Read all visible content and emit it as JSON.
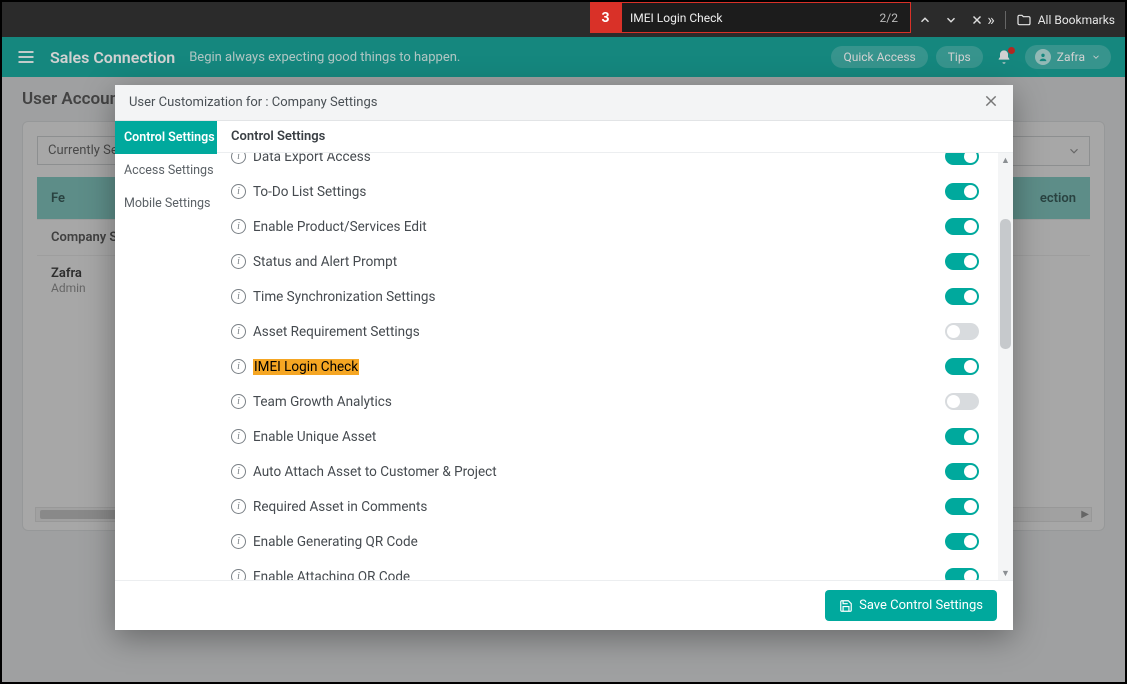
{
  "browser": {
    "find": {
      "badge": "3",
      "text": "IMEI Login Check",
      "count": "2/2"
    },
    "bookmarks_label": "All Bookmarks"
  },
  "header": {
    "title": "Sales Connection",
    "tagline": "Begin always expecting good things to happen.",
    "quick_access": "Quick Access",
    "tips": "Tips",
    "user": "Zafra"
  },
  "background": {
    "page_title": "User Account",
    "filter_label": "Currently Se",
    "col_left": "Fe",
    "col_right": "ection",
    "first_cell": "Company S",
    "user_name": "Zafra",
    "user_role": "Admin"
  },
  "modal": {
    "title": "User Customization for : Company Settings",
    "section_header": "Control Settings",
    "sidebar": {
      "items": [
        {
          "label": "Control Settings",
          "active": true
        },
        {
          "label": "Access Settings",
          "active": false
        },
        {
          "label": "Mobile Settings",
          "active": false
        }
      ]
    },
    "settings": [
      {
        "label": "Data Export Access",
        "on": true,
        "highlight": false
      },
      {
        "label": "To-Do List Settings",
        "on": true,
        "highlight": false
      },
      {
        "label": "Enable Product/Services Edit",
        "on": true,
        "highlight": false
      },
      {
        "label": "Status and Alert Prompt",
        "on": true,
        "highlight": false
      },
      {
        "label": "Time Synchronization Settings",
        "on": true,
        "highlight": false
      },
      {
        "label": "Asset Requirement Settings",
        "on": false,
        "highlight": false
      },
      {
        "label": "IMEI Login Check",
        "on": true,
        "highlight": true
      },
      {
        "label": "Team Growth Analytics",
        "on": false,
        "highlight": false
      },
      {
        "label": "Enable Unique Asset",
        "on": true,
        "highlight": false
      },
      {
        "label": "Auto Attach Asset to Customer & Project",
        "on": true,
        "highlight": false
      },
      {
        "label": "Required Asset in Comments",
        "on": true,
        "highlight": false
      },
      {
        "label": "Enable Generating QR Code",
        "on": true,
        "highlight": false
      },
      {
        "label": "Enable Attaching QR Code",
        "on": true,
        "highlight": false
      }
    ],
    "save_label": "Save Control Settings"
  }
}
